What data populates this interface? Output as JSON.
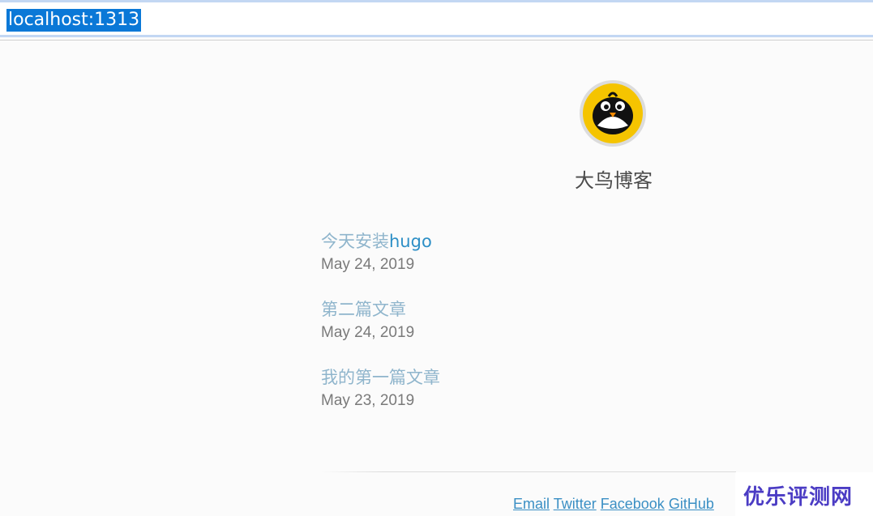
{
  "browser": {
    "address": "localhost:1313"
  },
  "site": {
    "title": "大鸟博客",
    "avatar_icon": "penguin-avatar-icon"
  },
  "posts": [
    {
      "title_prefix": "今天安装",
      "title_highlight": "hugo",
      "date": "May 24, 2019"
    },
    {
      "title_prefix": "第二篇文章",
      "title_highlight": "",
      "date": "May 24, 2019"
    },
    {
      "title_prefix": "我的第一篇文章",
      "title_highlight": "",
      "date": "May 23, 2019"
    }
  ],
  "footer": {
    "links": [
      "Email",
      "Twitter",
      "Facebook",
      "GitHub"
    ]
  },
  "watermark": {
    "text": "优乐评测网"
  },
  "colors": {
    "link": "#3a8fc4",
    "post_title": "#8fb5cc",
    "avatar_bg": "#f5c400",
    "selection": "#0a78d7"
  }
}
